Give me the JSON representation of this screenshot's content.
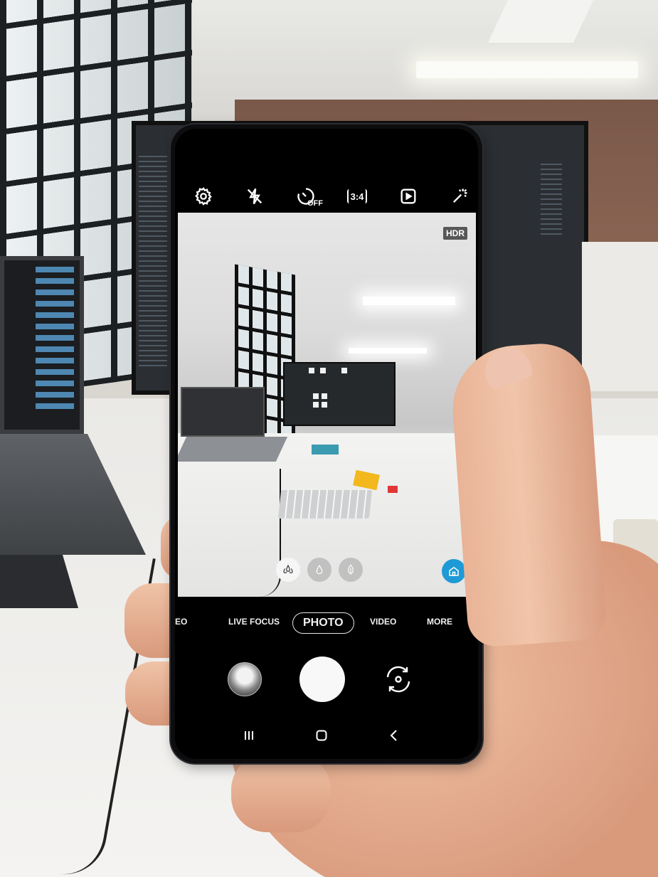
{
  "camera": {
    "top_bar": {
      "settings_icon": "gear-icon",
      "flash_icon": "flash-off-icon",
      "timer_label": "OFF",
      "ratio_label": "3:4",
      "motion_photo_icon": "motion-photo-icon",
      "effects_icon": "sparkle-icon"
    },
    "viewfinder": {
      "hdr_label": "HDR",
      "filters": [
        "filter-1",
        "filter-2",
        "filter-3"
      ],
      "scene_optimizer_icon": "home-icon"
    },
    "modes": [
      "EO",
      "LIVE FOCUS",
      "PHOTO",
      "VIDEO",
      "MORE"
    ],
    "selected_mode": "PHOTO",
    "accent_color": "#1e9ad6"
  }
}
